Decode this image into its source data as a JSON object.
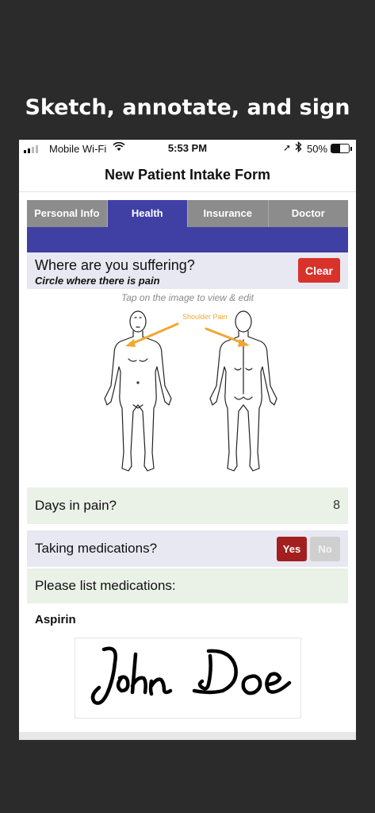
{
  "headline": "Sketch, annotate, and sign",
  "status_bar": {
    "carrier": "Mobile Wi-Fi",
    "time": "5:53 PM",
    "battery": "50%",
    "battery_level": 0.5
  },
  "nav": {
    "title": "New Patient Intake Form"
  },
  "tabs": [
    {
      "label": "Personal Info",
      "active": false
    },
    {
      "label": "Health",
      "active": true
    },
    {
      "label": "Insurance",
      "active": false
    },
    {
      "label": "Doctor",
      "active": false
    }
  ],
  "pain_section": {
    "question": "Where are you suffering?",
    "subtitle": "Circle where there is pain",
    "clear_label": "Clear",
    "tap_hint": "Tap on the image to view & edit",
    "annotation": "Shoulder Pain"
  },
  "days_in_pain": {
    "label": "Days in pain?",
    "value": "8"
  },
  "medications": {
    "label": "Taking medications?",
    "yes_label": "Yes",
    "no_label": "No",
    "selected": "Yes"
  },
  "med_list": {
    "label": "Please list medications:",
    "value": "Aspirin"
  },
  "signature": {
    "name": "John Doe"
  },
  "colors": {
    "background": "#2b2b2b",
    "tab_active": "#3f3fa4",
    "tab_inactive": "#8c8c8c",
    "clear": "#d9322a",
    "yes": "#a31f1f",
    "annotation": "#f0a830"
  }
}
